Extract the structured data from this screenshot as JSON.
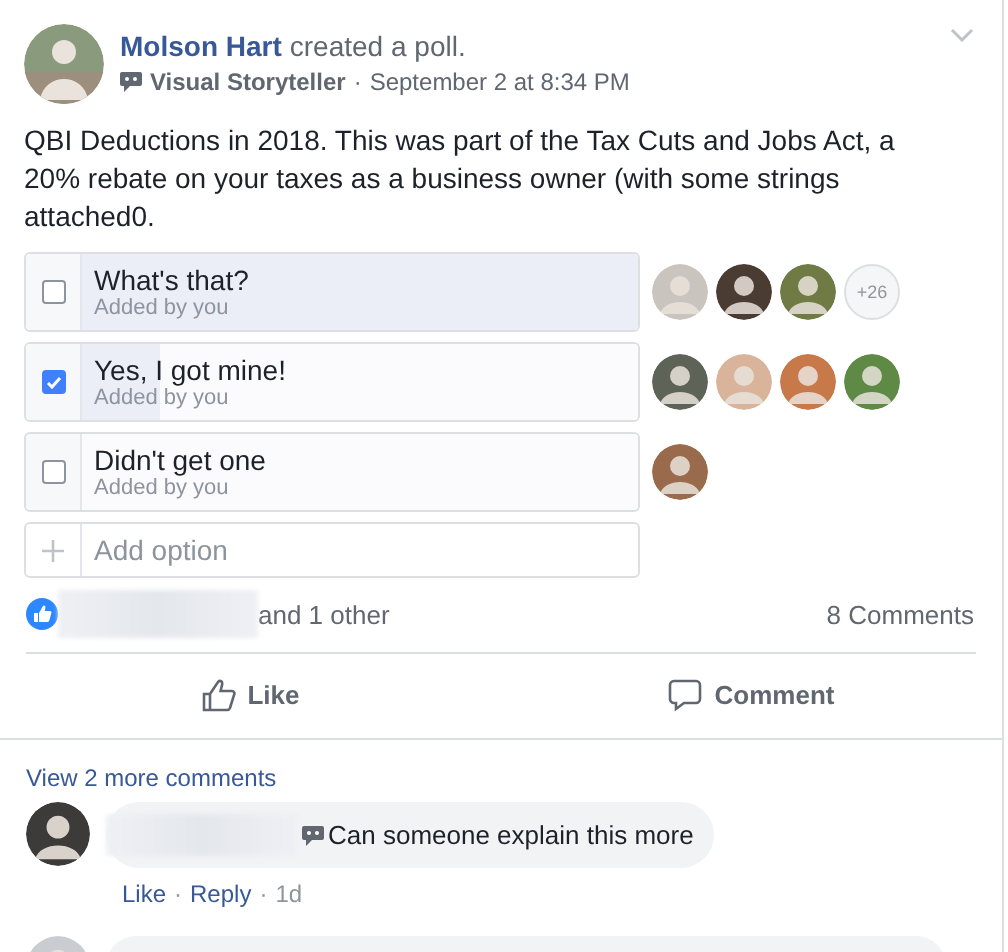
{
  "post": {
    "author": "Molson Hart",
    "action": "created a poll.",
    "badge": "Visual Storyteller",
    "separator": "·",
    "time": "September 2 at 8:34 PM",
    "text": "QBI Deductions in 2018. This was part of the Tax Cuts and Jobs Act, a 20% rebate on your taxes as a business owner (with some strings attached0."
  },
  "poll": {
    "options": [
      {
        "label": "What's that?",
        "note": "Added by you",
        "checked": false,
        "level": 1.0,
        "voters": [
          {
            "color": "#c9c4bd"
          },
          {
            "color": "#4a3b33"
          },
          {
            "color": "#6f7a45"
          }
        ],
        "more": "+26"
      },
      {
        "label": "Yes, I got mine!",
        "note": "Added by you",
        "checked": true,
        "level": 0.14,
        "voters": [
          {
            "color": "#5d6356"
          },
          {
            "color": "#d9b49a"
          },
          {
            "color": "#c7794a"
          },
          {
            "color": "#5f8a45"
          }
        ]
      },
      {
        "label": "Didn't get one",
        "note": "Added by you",
        "checked": false,
        "voters": [
          {
            "color": "#9a6a4c"
          }
        ]
      }
    ],
    "add_option": {
      "placeholder": "Add option"
    }
  },
  "reactions": {
    "others": "and 1 other",
    "comments": "8 Comments"
  },
  "actions": [
    {
      "kind": "like",
      "label": "Like"
    },
    {
      "kind": "comment",
      "label": "Comment"
    }
  ],
  "comments": {
    "view_more": "View 2 more comments",
    "items": [
      {
        "text": "Can someone explain this more",
        "like": "Like",
        "reply": "Reply",
        "separator": "·",
        "age": "1d"
      }
    ]
  }
}
